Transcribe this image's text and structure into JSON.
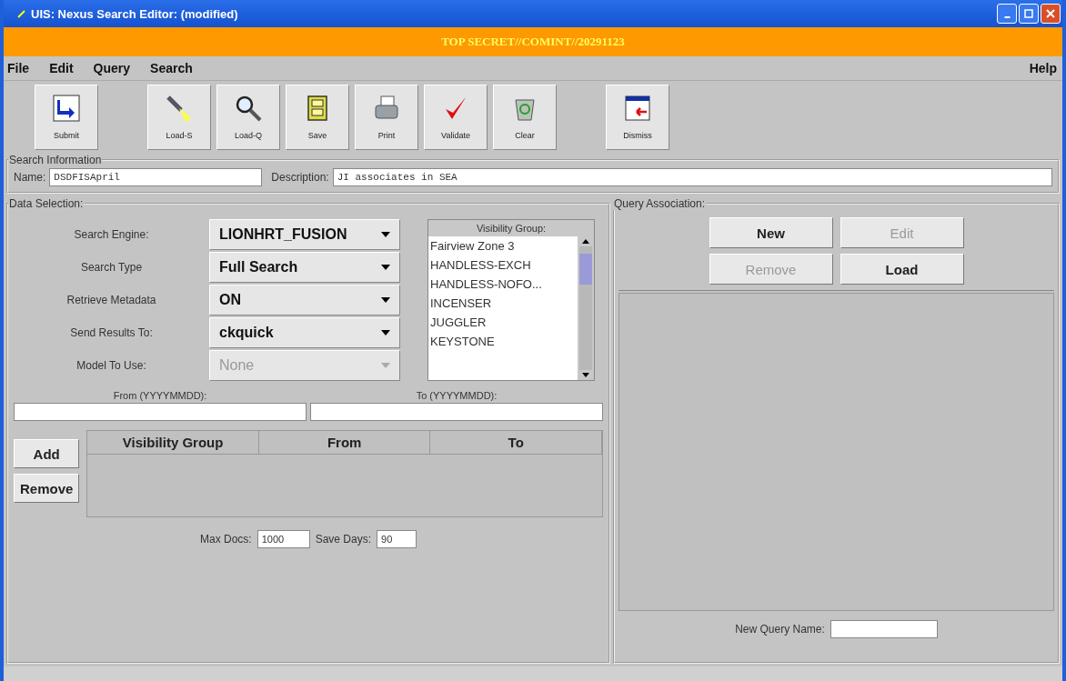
{
  "window": {
    "title": "UIS: Nexus Search Editor: (modified)"
  },
  "classification_banner": "TOP SECRET//COMINT//20291123",
  "menu": {
    "left": [
      "File",
      "Edit",
      "Query",
      "Search"
    ],
    "right": [
      "Help"
    ]
  },
  "toolbar": [
    {
      "label": "Submit"
    },
    {
      "label": "Load-S"
    },
    {
      "label": "Load-Q"
    },
    {
      "label": "Save"
    },
    {
      "label": "Print"
    },
    {
      "label": "Validate"
    },
    {
      "label": "Clear"
    },
    {
      "label": "Dismiss"
    }
  ],
  "search_information": {
    "title": "Search Information",
    "name_label": "Name:",
    "name_value": "DSDFISApril",
    "description_label": "Description:",
    "description_value": "JI associates in SEA"
  },
  "data_selection": {
    "title": "Data Selection:",
    "combos": [
      {
        "label": "Search Engine:",
        "value": "LIONHRT_FUSION",
        "disabled": false
      },
      {
        "label": "Search Type",
        "value": "Full Search",
        "disabled": false
      },
      {
        "label": "Retrieve Metadata",
        "value": "ON",
        "disabled": false
      },
      {
        "label": "Send Results To:",
        "value": "ckquick",
        "disabled": false
      },
      {
        "label": "Model To Use:",
        "value": "None",
        "disabled": true
      }
    ],
    "visibility_list": {
      "header": "Visibility Group:",
      "items": [
        "Fairview Zone 3",
        "HANDLESS-EXCH",
        "HANDLESS-NOFO...",
        "INCENSER",
        "JUGGLER",
        "KEYSTONE"
      ]
    },
    "from_label": "From (YYYYMMDD):",
    "to_label": "To (YYYYMMDD):",
    "buttons": [
      "Add",
      "Remove"
    ],
    "table": {
      "columns": [
        "Visibility Group",
        "From",
        "To"
      ]
    },
    "max_docs_label": "Max Docs:",
    "max_docs_value": "1000",
    "save_days_label": "Save Days:",
    "save_days_value": "90"
  },
  "query_association": {
    "title": "Query Association:",
    "buttons": [
      {
        "label": "New",
        "disabled": false
      },
      {
        "label": "Edit",
        "disabled": true
      },
      {
        "label": "Remove",
        "disabled": true
      },
      {
        "label": "Load",
        "disabled": false
      }
    ],
    "new_query_name_label": "New Query Name:"
  }
}
